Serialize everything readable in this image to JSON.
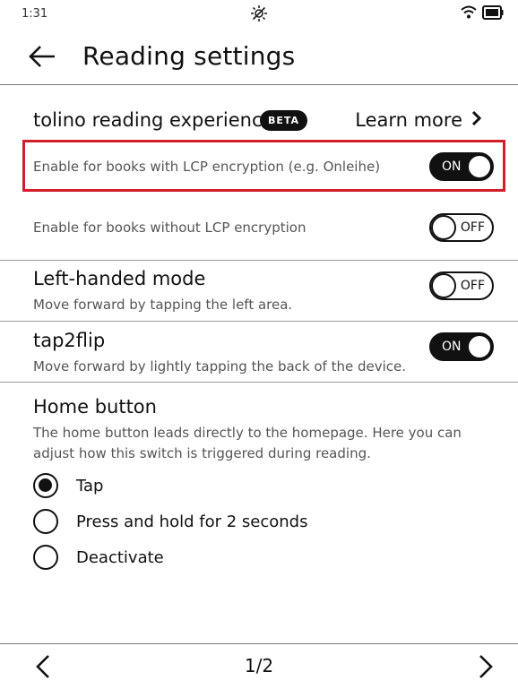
{
  "status": {
    "time": "1:31"
  },
  "header": {
    "title": "Reading settings"
  },
  "reading_experience": {
    "title": "tolino reading experience",
    "badge": "BETA",
    "learn_more": "Learn more",
    "lcp_label": "Enable for books with LCP encryption (e.g. Onleihe)",
    "lcp_toggle": "ON",
    "no_lcp_label": "Enable for books without LCP encryption",
    "no_lcp_toggle": "OFF"
  },
  "left_handed": {
    "title": "Left-handed mode",
    "desc": "Move forward by tapping the left area.",
    "toggle": "OFF"
  },
  "tap2flip": {
    "title": "tap2flip",
    "desc": "Move forward by lightly tapping the back of the device.",
    "toggle": "ON"
  },
  "home_button": {
    "title": "Home button",
    "desc_line1": "The home button leads directly to the homepage. Here you can",
    "desc_line2": "adjust how this switch is triggered during reading.",
    "options": [
      {
        "label": "Tap",
        "selected": true
      },
      {
        "label": "Press and hold for 2 seconds",
        "selected": false
      },
      {
        "label": "Deactivate",
        "selected": false
      }
    ]
  },
  "footer": {
    "page": "1/2"
  },
  "icons": {
    "back": "arrow-left-icon",
    "chevron": "chevron-right-icon",
    "brightness": "brightness-off-icon",
    "wifi": "wifi-icon",
    "battery": "battery-icon",
    "prev": "chevron-left-icon",
    "next": "chevron-right-icon"
  },
  "colors": {
    "highlight": "#d21f2c",
    "text": "#111111",
    "muted": "#555555"
  }
}
